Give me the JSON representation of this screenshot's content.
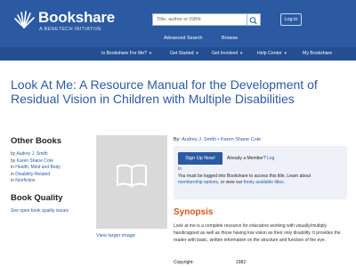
{
  "header": {
    "brand": "Bookshare",
    "tagline": "A BENETECH INITIATIVE",
    "search_placeholder": "Title, author or ISBN",
    "login": "Log in",
    "advanced_search": "Advanced Search",
    "browse": "Browse",
    "bg_color": "#2b5aa3"
  },
  "nav": {
    "items": [
      "Is Bookshare For Me?",
      "Get Started",
      "Get Involved",
      "Help Center",
      "My Bookshare"
    ]
  },
  "book": {
    "title": "Look At Me: A Resource Manual for the Development of Residual Vision in Children with Multiple Disabilities",
    "by_label": "By:",
    "authors": "Audrey J. Smith • Karen Shane Cote"
  },
  "left": {
    "other_books_heading": "Other Books",
    "other_books": [
      {
        "pre": "by ",
        "link": "Audrey J. Smith"
      },
      {
        "pre": "by ",
        "link": "Karen Shane Cote"
      },
      {
        "pre": "in ",
        "link": "Health, Mind and Body"
      },
      {
        "pre": "in ",
        "link": "Disability-Related"
      },
      {
        "pre": "in ",
        "link": "Nonfiction"
      }
    ],
    "quality_heading": "Book Quality",
    "quality_link": "See open book quality issues"
  },
  "cover": {
    "larger_image": "View larger image"
  },
  "membership": {
    "signup": "Sign Up Now!",
    "already": "Already a Member?",
    "log": "Log",
    "in": "In",
    "must_text": "You must be logged into Bookshare to access this title. Learn about",
    "membership_options": "membership options",
    "or_view": ", or view our",
    "freely_available": "freely available titles."
  },
  "synopsis": {
    "heading": "Synopsis",
    "text": "Look at me is a complete resource for educators working with visually/multiply handicapped as well as those having low vision as their only disability. It provides the reader with basic, written information on the structure and function of the eye."
  },
  "details": {
    "copyright_label": "Copyright:",
    "copyright_value": "1982"
  }
}
